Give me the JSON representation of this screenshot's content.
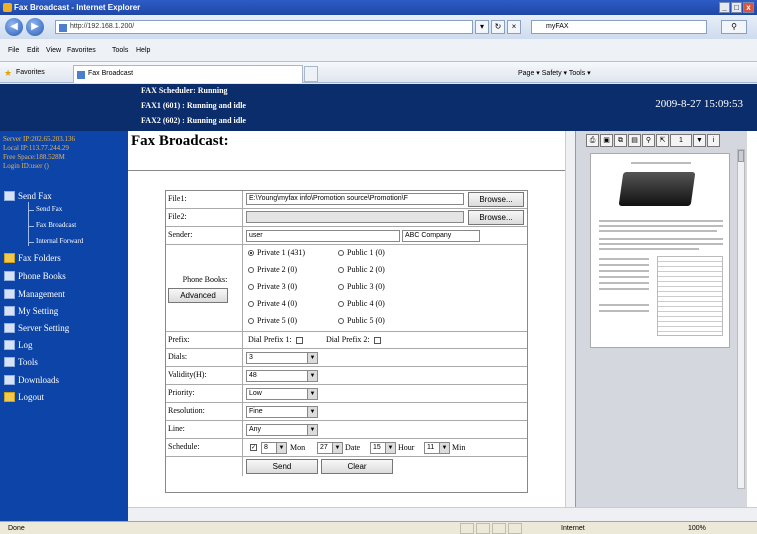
{
  "window": {
    "title": "Fax Broadcast - Internet Explorer",
    "controls": [
      "_",
      "□",
      "x"
    ]
  },
  "address_bar": {
    "url": "http://192.168.1.200/",
    "search_text": "myFAX"
  },
  "menu": {
    "items": [
      "File",
      "Edit",
      "View",
      "Favorites",
      "Tools",
      "Help"
    ]
  },
  "favorites_bar": {
    "favorites_label": "Favorites",
    "tab_label": "Fax Broadcast",
    "right_tools": "Page ▾   Safety ▾   Tools ▾"
  },
  "header": {
    "scheduler_status": "FAX Scheduler: Running",
    "fax1_status": "FAX1 (601)      : Running and idle",
    "fax2_status": "FAX2 (602)      : Running and idle",
    "datetime": "2009-8-27 15:09:53"
  },
  "sidebar": {
    "server_ip": "Server IP:202.65.203.136",
    "local_ip": "Local IP:113.77.244.29",
    "free_space": "Free Space:188.528M",
    "login_id": "Login ID:user ()",
    "send_fax": "Send Fax",
    "sub_send_fax": "Send Fax",
    "sub_fax_broadcast": "Fax Broadcast",
    "sub_internal_forward": "Internal Forward",
    "fax_folders": "Fax Folders",
    "phone_books": "Phone Books",
    "management": "Management",
    "my_setting": "My Setting",
    "server_setting": "Server Setting",
    "log": "Log",
    "tools": "Tools",
    "downloads": "Downloads",
    "logout": "Logout"
  },
  "main": {
    "title": "Fax Broadcast:"
  },
  "form": {
    "file1_label": "File1:",
    "file1_value": "E:\\Young\\myfax info\\Promotion source\\Promotion\\F",
    "file2_label": "File2:",
    "file2_value": "",
    "browse_label": "Browse...",
    "sender_label": "Sender:",
    "sender_value": "user",
    "company_value": "ABC Company",
    "phone_books_label": "Phone Books:",
    "advanced_label": "Advanced",
    "private": [
      "Private 1 (431)",
      "Private 2 (0)",
      "Private 3 (0)",
      "Private 4 (0)",
      "Private 5 (0)"
    ],
    "public": [
      "Public 1 (0)",
      "Public 2 (0)",
      "Public 3 (0)",
      "Public 4 (0)",
      "Public 5 (0)"
    ],
    "selected_book": "Private 1 (431)",
    "prefix_label": "Prefix:",
    "dial_prefix1": "Dial Prefix 1:",
    "dial_prefix2": "Dial Prefix 2:",
    "dials_label": "Dials:",
    "dials_value": "3",
    "validity_label": "Validity(H):",
    "validity_value": "48",
    "priority_label": "Priority:",
    "priority_value": "Low",
    "resolution_label": "Resolution:",
    "resolution_value": "Fine",
    "line_label": "Line:",
    "line_value": "Any",
    "schedule_label": "Schedule:",
    "schedule_checked": true,
    "month_value": "8",
    "month_unit": "Mon",
    "date_value": "27",
    "date_unit": "Date",
    "hour_value": "15",
    "hour_unit": "Hour",
    "min_value": "11",
    "min_unit": "Min",
    "send_label": "Send",
    "clear_label": "Clear"
  },
  "preview": {
    "page_value": "1"
  },
  "status_bar": {
    "left": "Done",
    "zone": "Internet",
    "zoom": "100%"
  },
  "colors": {
    "header_bg": "#0b2d6b",
    "sidebar_bg": "#0d44a8",
    "sidebar_info": "#e9b44c"
  }
}
